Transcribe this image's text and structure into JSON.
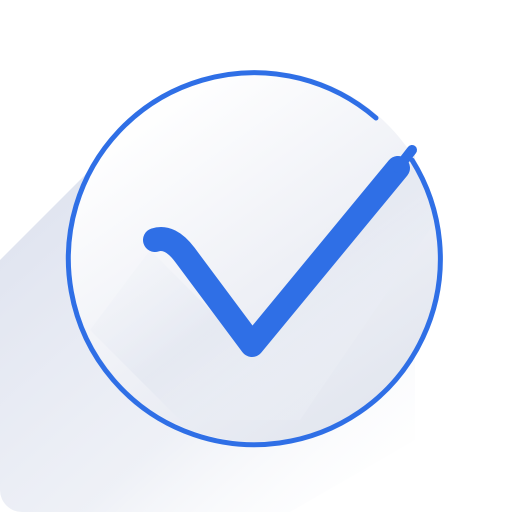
{
  "icon": {
    "name": "checkmark-circle-icon",
    "colors": {
      "background": "#ffffff",
      "accent": "#2f6fe6",
      "shadow": "#d9deec",
      "circle_fill_top": "#ffffff",
      "circle_fill_bottom": "#e8ebf3"
    }
  }
}
